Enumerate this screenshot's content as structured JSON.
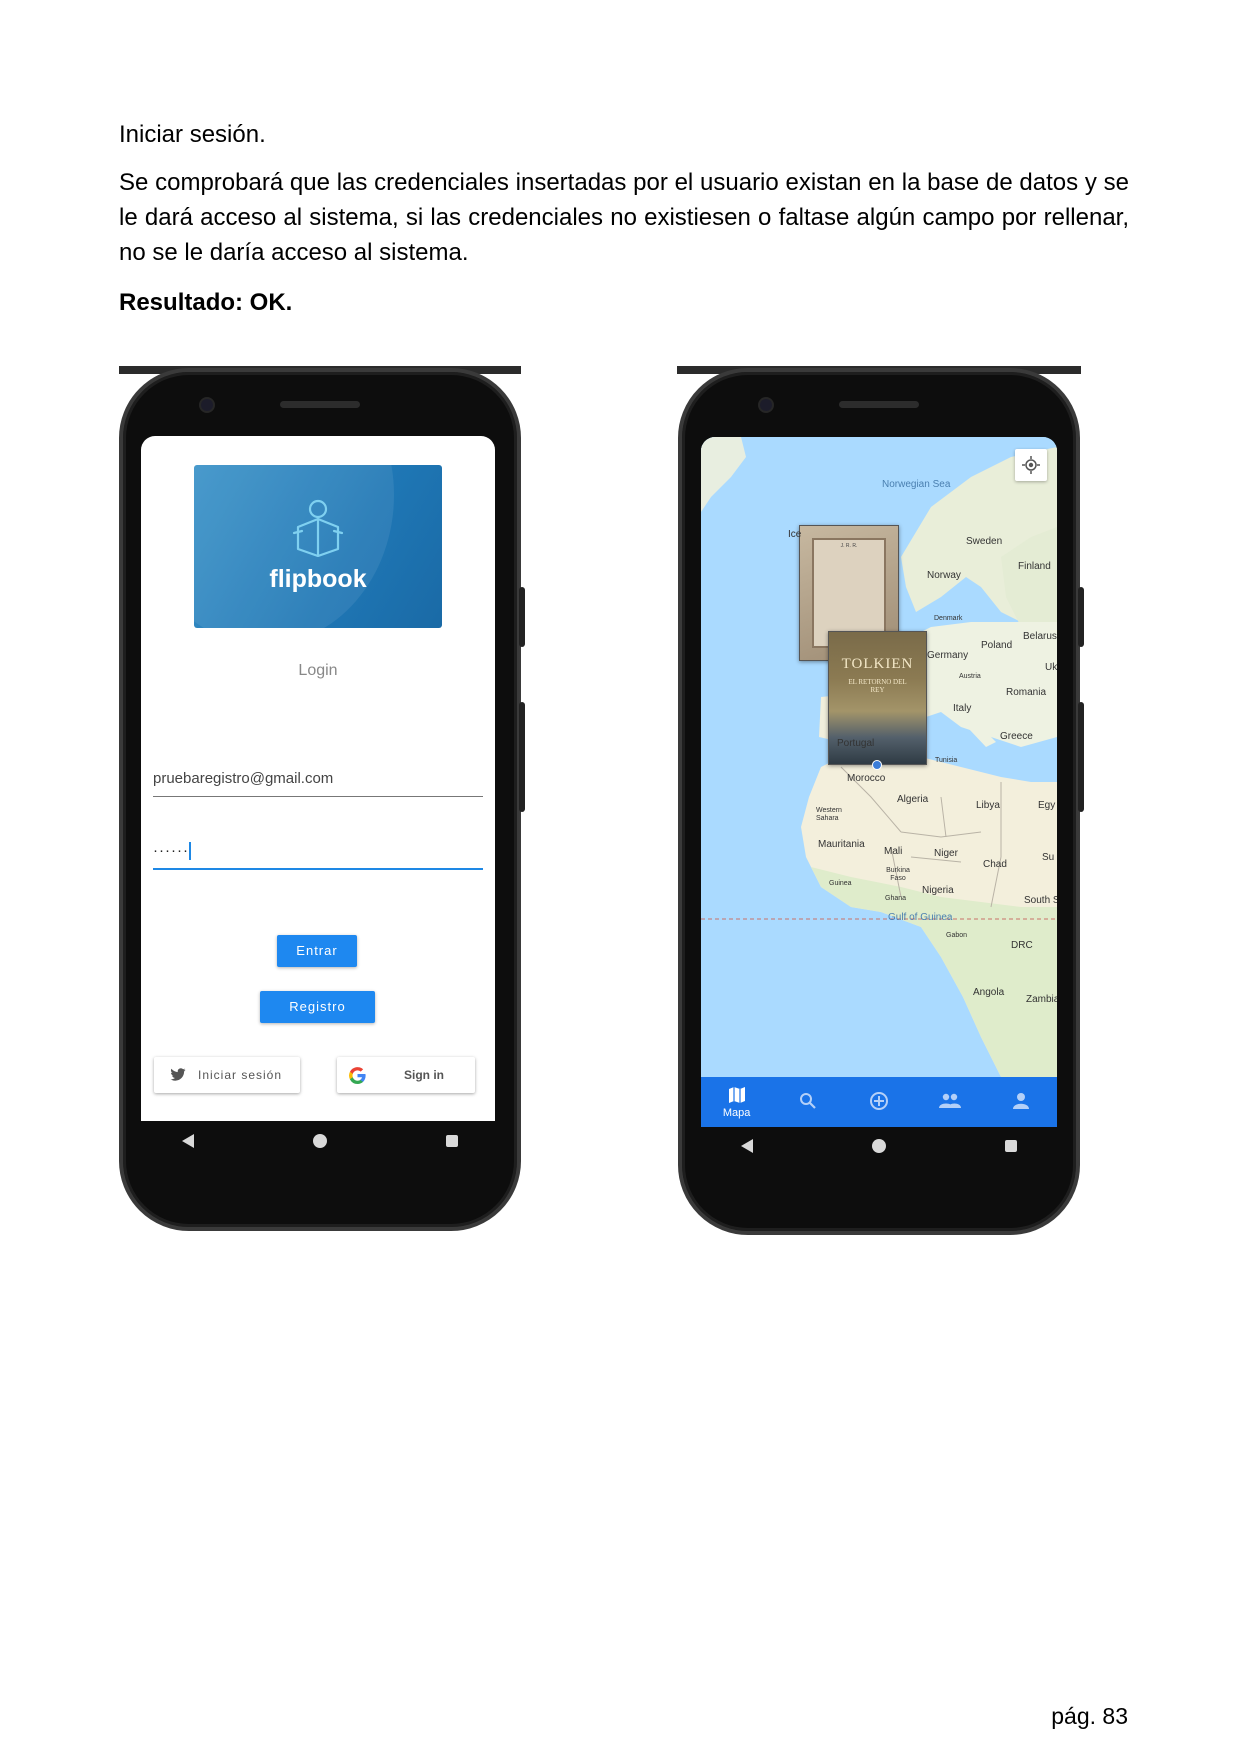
{
  "doc": {
    "heading": "Iniciar sesión.",
    "body": "Se comprobará que las credenciales insertadas por el usuario existan en la base de datos y se le dará acceso al sistema, si las credenciales no existiesen o faltase algún campo por rellenar, no se le daría acceso al sistema.",
    "result": "Resultado: OK.",
    "page_number": "pág. 83"
  },
  "login": {
    "logo_text": "flipbook",
    "title": "Login",
    "email_value": "pruebaregistro@gmail.com",
    "password_mask": "······",
    "enter_label": "Entrar",
    "register_label": "Registro",
    "twitter_label": "Iniciar sesión",
    "google_label": "Sign in",
    "accent": "#1e88f0"
  },
  "map": {
    "labels": {
      "norwegian_sea": "Norwegian Sea",
      "sweden": "Sweden",
      "finland": "Finland",
      "norway": "Norway",
      "denmark": "Denmark",
      "poland": "Poland",
      "belarus": "Belarus",
      "germany": "Germany",
      "austria": "Austria",
      "ukraine": "Uk",
      "romania": "Romania",
      "italy": "Italy",
      "greece": "Greece",
      "portugal": "Portugal",
      "tunisia": "Tunisia",
      "morocco": "Morocco",
      "algeria": "Algeria",
      "libya": "Libya",
      "egypt": "Egy",
      "western_sahara": "Western Sahara",
      "mauritania": "Mauritania",
      "mali": "Mali",
      "niger": "Niger",
      "chad": "Chad",
      "sudan": "Su",
      "burkina": "Burkina Faso",
      "guinea": "Guinea",
      "ghana": "Ghana",
      "nigeria": "Nigeria",
      "gulf_guinea": "Gulf of Guinea",
      "south_sudan": "South S",
      "gabon": "Gabon",
      "drc": "DRC",
      "angola": "Angola",
      "zambia": "Zambia",
      "iceland": "Ice"
    },
    "book_title": "TOLKIEN",
    "book_subtitle": "EL RETORNO DEL REY",
    "book_author_top": "J. R. R.",
    "nav": {
      "map_label": "Mapa",
      "icons": [
        "map-icon",
        "search-icon",
        "add-circle-icon",
        "people-icon",
        "person-icon"
      ]
    },
    "nav_color": "#1a73e8"
  }
}
